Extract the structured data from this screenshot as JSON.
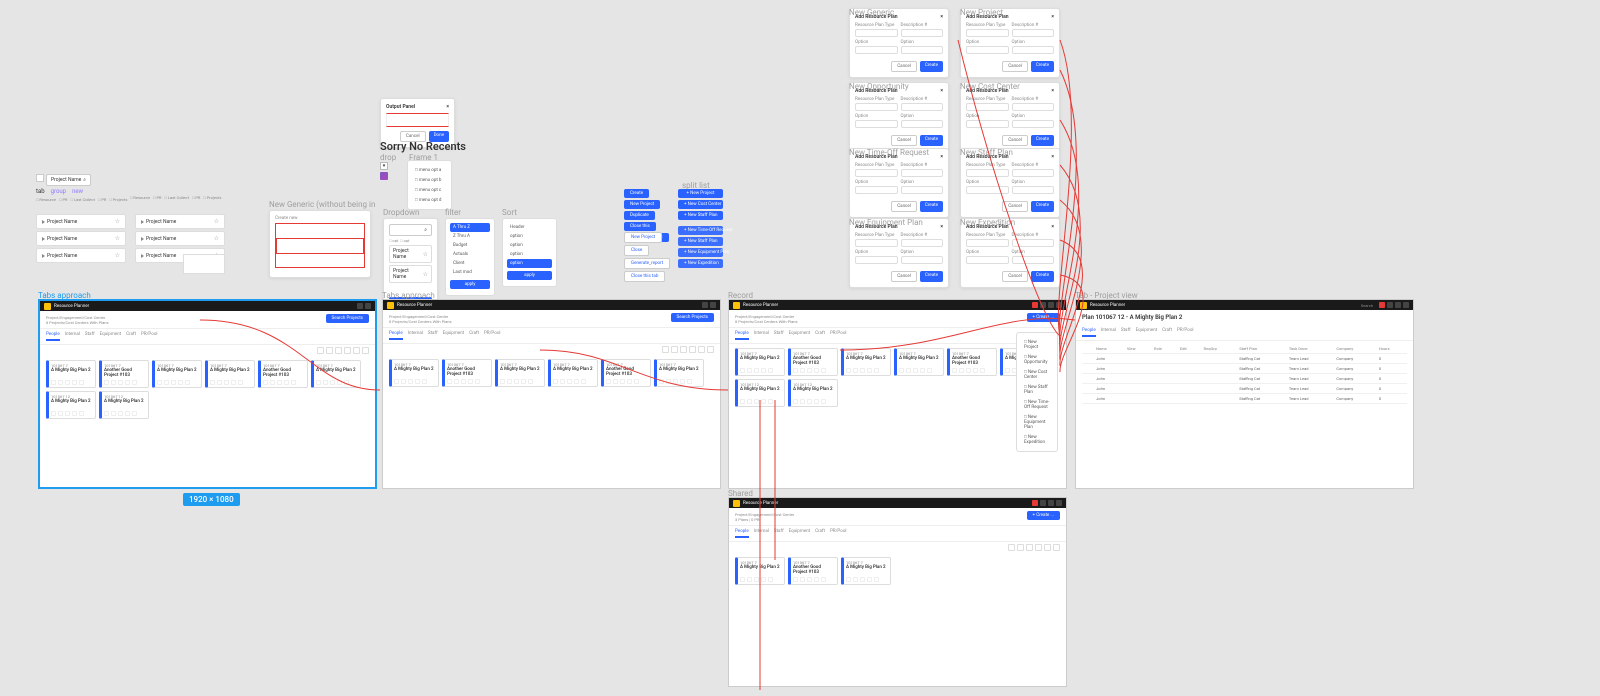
{
  "top_left": {
    "search_placeholder": "Project Name",
    "tab_label": "tab",
    "group_label": "group",
    "new_label": "new",
    "row_label": "Project Name"
  },
  "recents_dialog": {
    "title": "Output Panel",
    "cancel": "Cancel",
    "done": "Done",
    "empty_heading": "Sorry No Recents"
  },
  "drop": {
    "frame1": "drop",
    "frame2": "Frame 1"
  },
  "generic_box": {
    "label": "New Generic (without being in",
    "row1": "Create new"
  },
  "dropdown": {
    "label": "Dropdown",
    "row": "Project Name"
  },
  "filter": {
    "label": "filter",
    "options": [
      "A Thru Z",
      "Z Thru A",
      "Budget",
      "Actuals",
      "Client",
      "Last mod"
    ],
    "apply": "apply"
  },
  "sort": {
    "label": "Sort",
    "options": [
      "Header",
      "option",
      "option",
      "option",
      "option"
    ],
    "apply": "apply"
  },
  "linkcol": {
    "items": [
      "Create",
      "New Project",
      "Duplicate",
      "Close this",
      "Generate Report"
    ],
    "ghosts": [
      "New Project",
      "Close",
      "Generate_report",
      "Close this tab"
    ]
  },
  "splitlist": {
    "label": "split list",
    "primary": [
      "New Project",
      "New Cost Center",
      "New Staff Plan"
    ],
    "secondary": [
      "New Time-Off Request",
      "New Staff Plan",
      "New Equipment Plan",
      "New Expedition"
    ]
  },
  "dialog_cluster": {
    "titles": [
      "New Generic",
      "New Project",
      "New Opportunity",
      "New Cost Center",
      "New Time-Off Request",
      "New Staff Plan",
      "New Equipment Plan",
      "New Expedition"
    ],
    "modal_title": "Add Resource Plan",
    "field1": "Resource Plan Type",
    "field2": "Description #",
    "cancel": "Cancel",
    "create": "Create"
  },
  "app": {
    "title": "Resource Planner",
    "crumb": "Project/Engagement/Cost Center",
    "crumbsub": "8 Projects/Cost Centers With Plans",
    "searchbtn": "Search Projects",
    "tabs": [
      "People",
      "Internal",
      "Staff",
      "Equipment",
      "Craft",
      "PR/Pool"
    ],
    "cards": [
      {
        "id": "101067 7",
        "name": "A Mighty Big Plan 2"
      },
      {
        "id": "101067 7",
        "name": "Another Good Project #103"
      },
      {
        "id": "101067 7",
        "name": "A Mighty Big Plan 2"
      },
      {
        "id": "101067 7",
        "name": "A Mighty Big Plan 2"
      },
      {
        "id": "101067 7",
        "name": "Another Good Project #103"
      },
      {
        "id": "101067 7",
        "name": "A Mighty Big Plan 2"
      },
      {
        "id": "101067 12",
        "name": "A Mighty Big Plan 2"
      },
      {
        "id": "101067 12",
        "name": "A Mighty Big Plan 2"
      }
    ]
  },
  "tabs_label": "Tabs approach",
  "record_label": "Record",
  "shared_label": "Shared",
  "projview_label": "Tab - Project view",
  "projview": {
    "title": "Plan 101067 12 - A Mighty Big Plan 2",
    "cols": [
      "",
      "Name",
      "View",
      "Role",
      "Edit",
      "ReqGrp",
      "Staff Plan",
      "Task Done",
      "Company",
      "Hours"
    ],
    "row": [
      "",
      "John",
      "",
      "",
      "",
      "",
      "Staffing Cat",
      "Team Lead",
      "Company",
      "0"
    ]
  },
  "dim_label": "1920 × 1080"
}
